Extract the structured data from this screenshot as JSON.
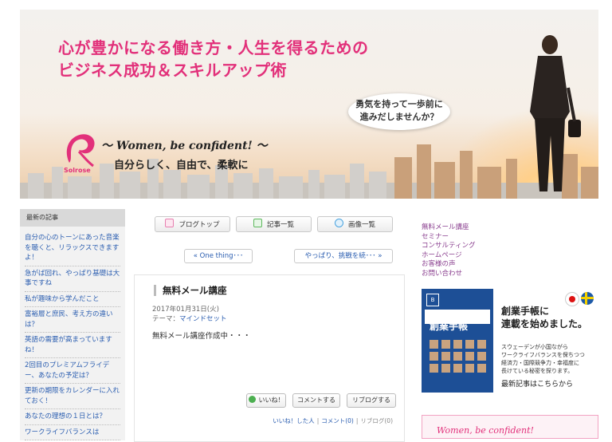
{
  "banner": {
    "headline_line1": "心が豊かになる働き方・人生を得るための",
    "headline_line2": "ビジネス成功＆スキルアップ術",
    "bubble_line1": "勇気を持って一歩前に",
    "bubble_line2": "進みだしませんか？",
    "logo_text": "Solrose",
    "tagline_en": "～ Women, be confident! ～",
    "tagline_jp": "自分らしく、自由で、柔軟に"
  },
  "sidebar": {
    "heading": "最新の記事",
    "items": [
      {
        "label": "自分の心のトーンにあった音楽を聴くと、リラックスできますよ！"
      },
      {
        "label": "急がば回れ、やっぱり基礎は大事ですね"
      },
      {
        "label": "私が趣味から学んだこと"
      },
      {
        "label": "富裕層と庶民、考え方の違いは？"
      },
      {
        "label": "英語の需要が高まっていますね！"
      },
      {
        "label": "2回目のプレミアムフライデー、あなたの予定は？"
      },
      {
        "label": "更新の期限をカレンダーに入れておく！"
      },
      {
        "label": "あなたの理想の１日とは？"
      },
      {
        "label": "ワークライフバランスは"
      }
    ]
  },
  "nav": {
    "blog_top": "ブログトップ",
    "article_list": "記事一覧",
    "image_list": "画像一覧",
    "prev": "« One thing･･･",
    "next": "やっぱり、挑戦を続･･･ »"
  },
  "article": {
    "title": "無料メール講座",
    "date": "2017年01月31日(火)",
    "theme_label": "テーマ：",
    "theme": "マインドセット",
    "body": "無料メール講座作成中・・・",
    "like_button": "いいね！",
    "comment_button": "コメントする",
    "reblog_button": "リブログする",
    "liked_by": "いいね！した人",
    "comments": "コメント(0)",
    "reblogs": "リブログ(0)"
  },
  "right": {
    "links": [
      {
        "label": "無料メール講座"
      },
      {
        "label": "セミナー"
      },
      {
        "label": "コンサルティング"
      },
      {
        "label": "ホームページ"
      },
      {
        "label": "お客様の声"
      },
      {
        "label": "お問い合わせ"
      }
    ],
    "promo": {
      "book_title": "創業手帳",
      "book_mark": "B",
      "headline1": "創業手帳に",
      "headline2": "連載を始めました。",
      "sub1": "スウェーデンが小国ながら",
      "sub2": "ワークライフバランスを保ちつつ",
      "sub3": "経済力・国際競争力・幸福度に",
      "sub4": "長けている秘密を探ります。",
      "link": "最新記事はこちらから"
    },
    "bottom_banner": "Women, be confident!"
  },
  "colors": {
    "accent_pink": "#e2307a",
    "link_blue": "#2a5db0",
    "link_purple": "#8a3f8f"
  }
}
